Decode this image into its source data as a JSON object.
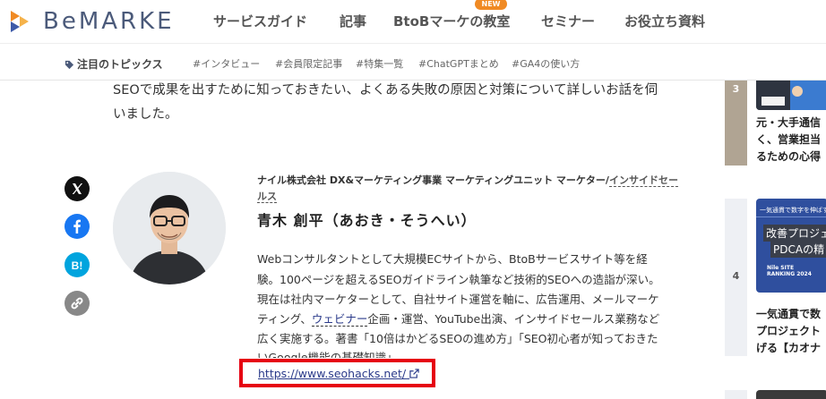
{
  "header": {
    "logo_text": "BeMARKE",
    "nav": [
      {
        "label": "サービスガイド"
      },
      {
        "label": "記事"
      },
      {
        "label": "BtoBマーケの教室",
        "badge": "NEW"
      },
      {
        "label": "セミナー"
      },
      {
        "label": "お役立ち資料"
      }
    ]
  },
  "topics": {
    "heading": "注目のトピックス",
    "tags": [
      "#インタビュー",
      "#会員限定記事",
      "#特集一覧",
      "#ChatGPTまとめ",
      "#GA4の使い方"
    ]
  },
  "article": {
    "intro_lines": [
      "SEOで成果を出すために知っておきたい、よくある失敗の原因と対策について詳しいお話を伺",
      "いました。"
    ]
  },
  "share": {
    "icons": [
      "x-icon",
      "facebook-icon",
      "hatena-bookmark-icon",
      "link-icon"
    ],
    "hatena_label": "B!"
  },
  "author": {
    "role_prefix": "ナイル株式会社 DX&マーケティング事業 マーケティングユニット マーケター/",
    "role_link_1": "インサイドセー",
    "role_link_2": "ルス",
    "name": "青木 創平（あおき・そうへい）",
    "bio_lines": [
      "Webコンサルタントとして大規模ECサイトから、BtoBサービスサイト等を経",
      "験。100ページを超えるSEOガイドライン執筆など技術的SEOへの造詣が深い。",
      "現在は社内マーケターとして、自社サイト運営を軸に、広告運用、メールマーケ"
    ],
    "bio_line4_prefix": "ティング、",
    "bio_line4_link": "ウェビナー",
    "bio_line4_suffix": "企画・運営、YouTube出演、インサイドセールス業務など",
    "bio_lines_after": [
      "広く実施する。著書「10倍はかどるSEOの進め方」「SEO初心者が知っておきた",
      "いGoogle機能の基礎知識」"
    ],
    "url": "https://www.seohacks.net/"
  },
  "sidebar": {
    "items": [
      {
        "rank": "3",
        "lines": [
          "元・大手通信",
          "く、営業担当",
          "るための心得"
        ]
      },
      {
        "rank": "4",
        "thumb_lines": [
          "一気通貫で数字を伸ばす",
          "改善プロジェ",
          "PDCAの精",
          "Nile SITE RANKING 2024"
        ],
        "lines": [
          "一気通貫で数",
          "プロジェクト",
          "げる【カオナ"
        ]
      }
    ]
  },
  "colors": {
    "accent": "#f08a24",
    "logo": "#4b5a7a",
    "highlight": "#e60012",
    "link": "#2a3a8a"
  }
}
